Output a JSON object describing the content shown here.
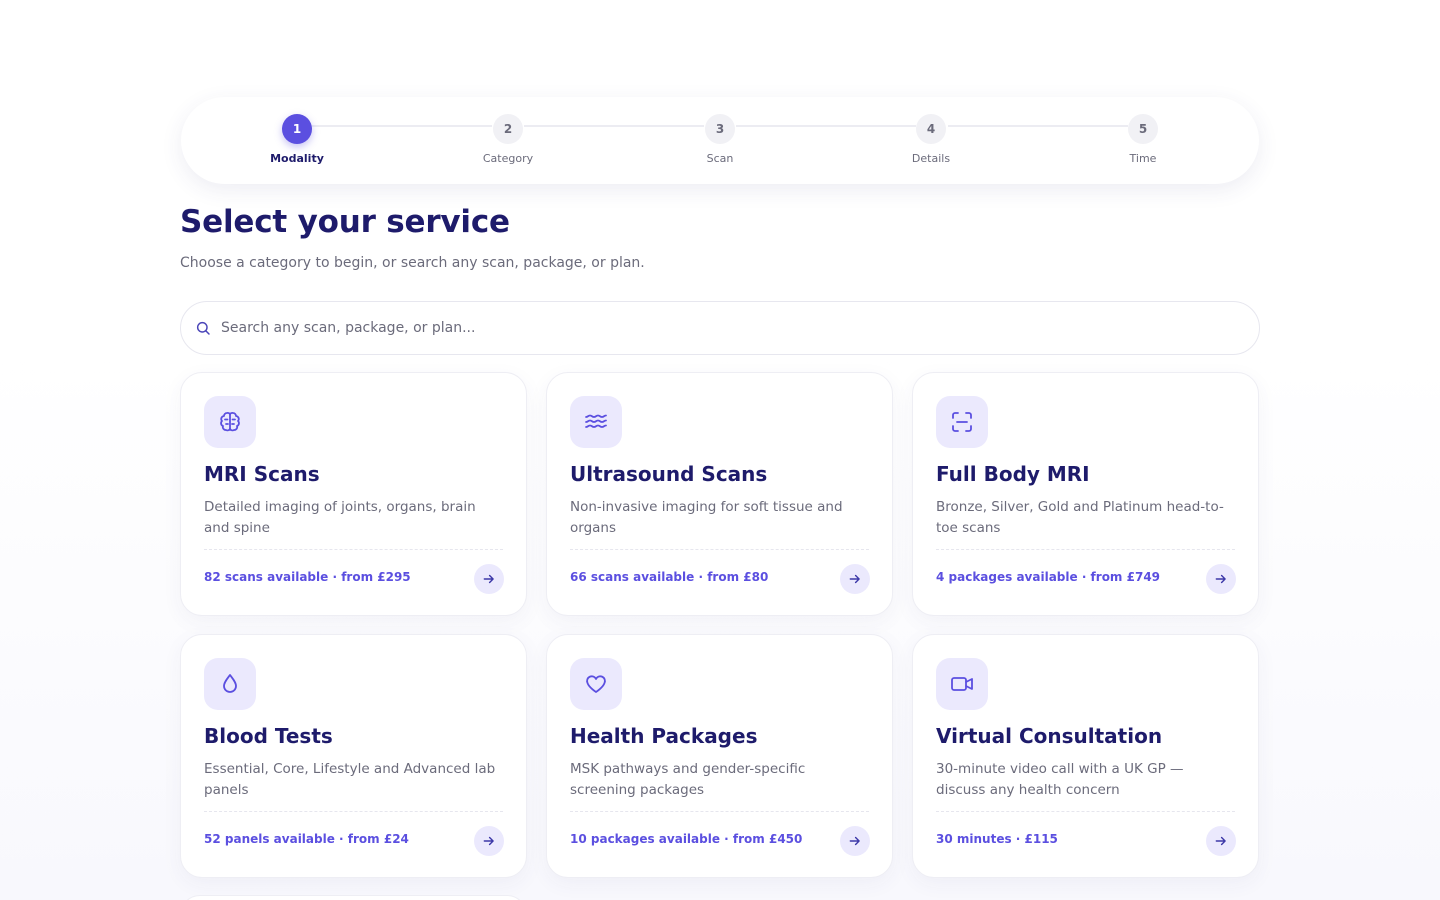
{
  "stepper": {
    "steps": [
      {
        "number": "1",
        "label": "Modality",
        "active": true
      },
      {
        "number": "2",
        "label": "Category",
        "active": false
      },
      {
        "number": "3",
        "label": "Scan",
        "active": false
      },
      {
        "number": "4",
        "label": "Details",
        "active": false
      },
      {
        "number": "5",
        "label": "Time",
        "active": false
      }
    ]
  },
  "header": {
    "title": "Select your service",
    "subtitle": "Choose a category to begin, or search any scan, package, or plan."
  },
  "search": {
    "placeholder": "Search any scan, package, or plan...",
    "value": ""
  },
  "colors": {
    "accent": "#5b4fe0",
    "heading": "#1e1b6b",
    "muted": "#6b6b7b",
    "icon_bg": "#ebe9fd"
  },
  "cards": [
    {
      "icon": "brain-icon",
      "title": "MRI Scans",
      "description": "Detailed imaging of joints, organs, brain and spine",
      "meta": "82 scans available · from £295"
    },
    {
      "icon": "waves-icon",
      "title": "Ultrasound Scans",
      "description": "Non-invasive imaging for soft tissue and organs",
      "meta": "66 scans available · from £80"
    },
    {
      "icon": "scan-frame-icon",
      "title": "Full Body MRI",
      "description": "Bronze, Silver, Gold and Platinum head-to-toe scans",
      "meta": "4 packages available · from £749"
    },
    {
      "icon": "droplet-icon",
      "title": "Blood Tests",
      "description": "Essential, Core, Lifestyle and Advanced lab panels",
      "meta": "52 panels available · from £24"
    },
    {
      "icon": "heart-icon",
      "title": "Health Packages",
      "description": "MSK pathways and gender-specific screening packages",
      "meta": "10 packages available · from £450"
    },
    {
      "icon": "video-camera-icon",
      "title": "Virtual Consultation",
      "description": "30-minute video call with a UK GP — discuss any health concern",
      "meta": "30 minutes · £115"
    }
  ]
}
